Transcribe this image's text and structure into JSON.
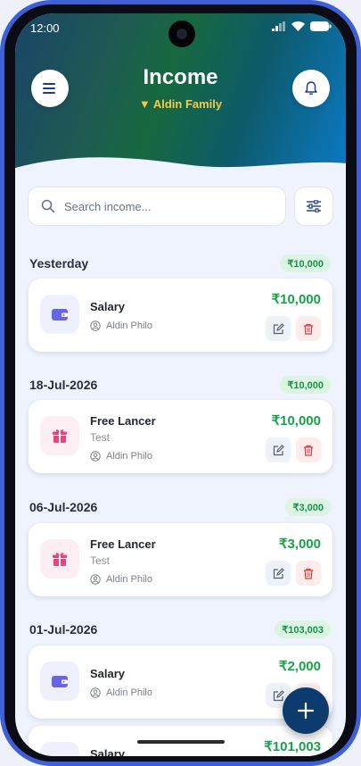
{
  "status": {
    "time": "12:00"
  },
  "header": {
    "title": "Income",
    "subtitle": "▼ Aldin Family"
  },
  "search": {
    "placeholder": "Search income..."
  },
  "groups": [
    {
      "label": "Yesterday",
      "total": "₹10,000",
      "items": [
        {
          "title": "Salary",
          "note": "",
          "user": "Aldin Philo",
          "amount": "₹10,000",
          "icon": "wallet-icon"
        }
      ]
    },
    {
      "label": "18-Jul-2026",
      "total": "₹10,000",
      "items": [
        {
          "title": "Free Lancer",
          "note": "Test",
          "user": "Aldin Philo",
          "amount": "₹10,000",
          "icon": "gift-icon"
        }
      ]
    },
    {
      "label": "06-Jul-2026",
      "total": "₹3,000",
      "items": [
        {
          "title": "Free Lancer",
          "note": "Test",
          "user": "Aldin Philo",
          "amount": "₹3,000",
          "icon": "gift-icon"
        }
      ]
    },
    {
      "label": "01-Jul-2026",
      "total": "₹103,003",
      "items": [
        {
          "title": "Salary",
          "note": "",
          "user": "Aldin Philo",
          "amount": "₹2,000",
          "icon": "wallet-icon"
        },
        {
          "title": "Salary",
          "note": "",
          "user": "",
          "amount": "₹101,003",
          "icon": "wallet-icon"
        }
      ]
    }
  ],
  "colors": {
    "accent": "#0e3b6e",
    "income_green": "#16a34a",
    "badge_bg": "#dcf5e3",
    "subtitle": "#f7c948"
  }
}
